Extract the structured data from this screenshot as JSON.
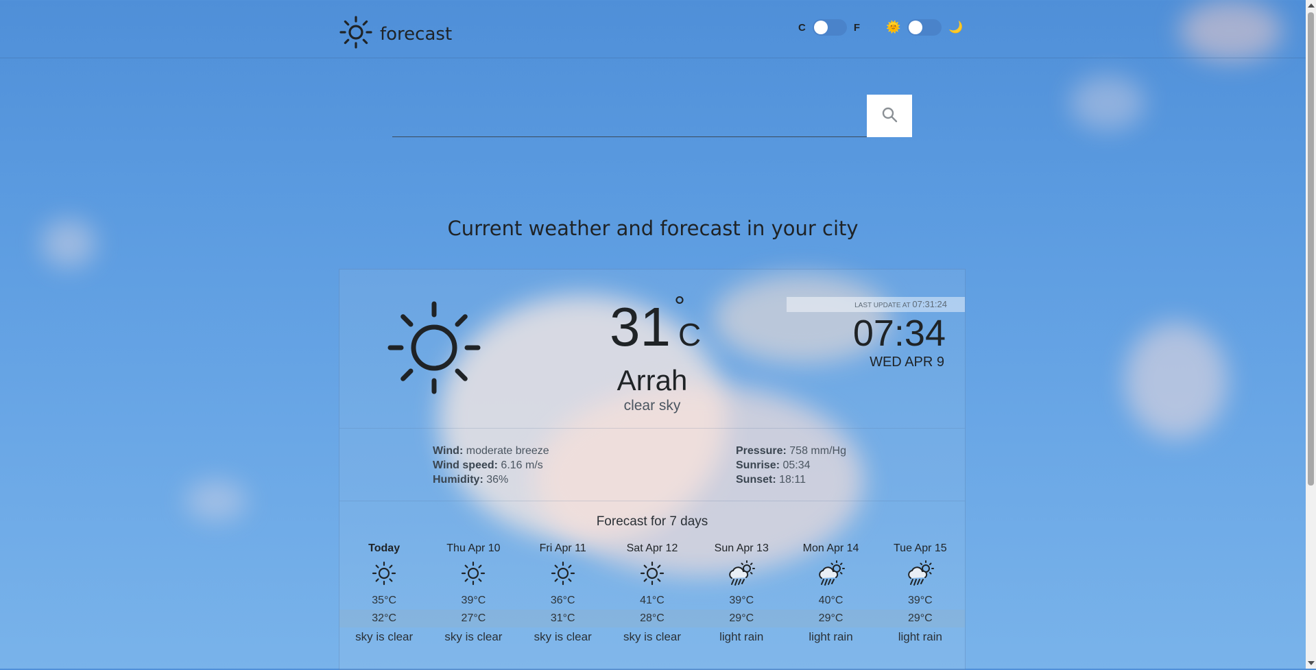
{
  "header": {
    "logo_text": "forecast",
    "unit_c": "C",
    "unit_f": "F",
    "theme_day_emoji": "🌞",
    "theme_night_emoji": "🌙"
  },
  "search": {
    "placeholder": "",
    "value": ""
  },
  "headline": "Current weather and forecast in your city",
  "current": {
    "icon": "sun-icon",
    "temp": "31",
    "deg": "°",
    "unit": "C",
    "city": "Arrah",
    "condition": "clear sky",
    "last_update_label": "LAST UPDATE AT",
    "last_update_time": "07:31:24",
    "clock": "07:34",
    "date": "WED APR 9"
  },
  "details": {
    "wind_label": "Wind:",
    "wind": "moderate breeze",
    "wind_speed_label": "Wind speed:",
    "wind_speed": "6.16 m/s",
    "humidity_label": "Humidity:",
    "humidity": "36%",
    "pressure_label": "Pressure:",
    "pressure": "758 mm/Hg",
    "sunrise_label": "Sunrise:",
    "sunrise": "05:34",
    "sunset_label": "Sunset:",
    "sunset": "18:11"
  },
  "forecast": {
    "title": "Forecast for 7 days",
    "days": [
      {
        "name": "Today",
        "icon": "sun-icon",
        "hi": "35°C",
        "lo": "32°C",
        "desc": "sky is clear"
      },
      {
        "name": "Thu Apr 10",
        "icon": "sun-icon",
        "hi": "39°C",
        "lo": "27°C",
        "desc": "sky is clear"
      },
      {
        "name": "Fri Apr 11",
        "icon": "sun-icon",
        "hi": "36°C",
        "lo": "31°C",
        "desc": "sky is clear"
      },
      {
        "name": "Sat Apr 12",
        "icon": "sun-icon",
        "hi": "41°C",
        "lo": "28°C",
        "desc": "sky is clear"
      },
      {
        "name": "Sun Apr 13",
        "icon": "sun-rain-icon",
        "hi": "39°C",
        "lo": "29°C",
        "desc": "light rain"
      },
      {
        "name": "Mon Apr 14",
        "icon": "sun-rain-icon",
        "hi": "40°C",
        "lo": "29°C",
        "desc": "light rain"
      },
      {
        "name": "Tue Apr 15",
        "icon": "sun-rain-icon",
        "hi": "39°C",
        "lo": "29°C",
        "desc": "light rain"
      }
    ]
  }
}
